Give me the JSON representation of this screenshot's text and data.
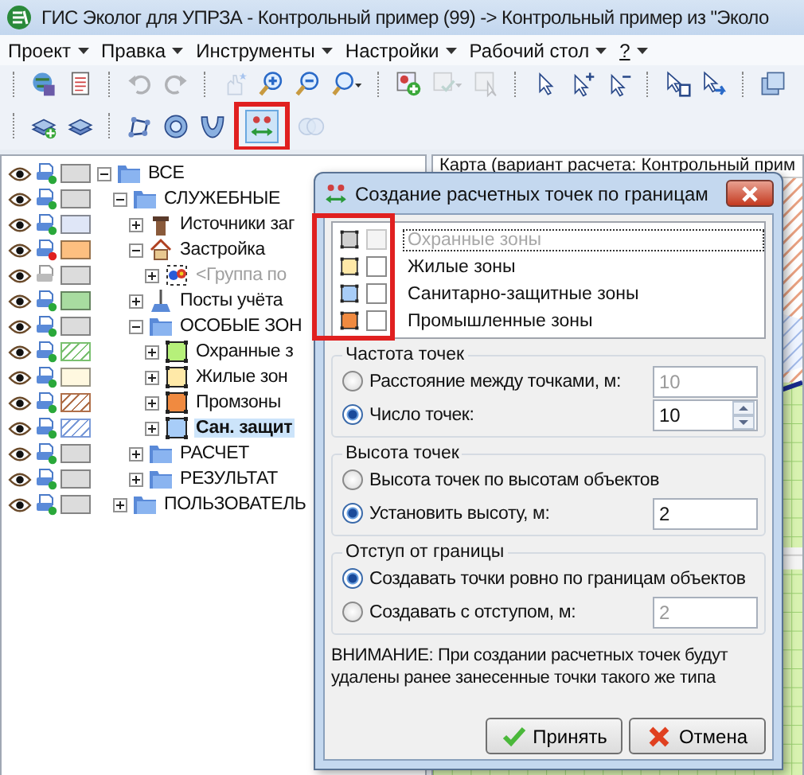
{
  "window": {
    "title": "ГИС Эколог для УПРЗА - Контрольный пример (99) -> Контрольный пример из \"Эколо"
  },
  "menu": [
    {
      "label": "Проект",
      "underline": false
    },
    {
      "label": "Правка",
      "underline": false
    },
    {
      "label": "Инструменты",
      "underline": false
    },
    {
      "label": "Настройки",
      "underline": false
    },
    {
      "label": "Рабочий стол",
      "underline": false
    },
    {
      "label": "?",
      "underline": true
    }
  ],
  "toolbars": [
    [
      {
        "kind": "separator"
      },
      {
        "kind": "globe-disk",
        "disabled": false,
        "selected": false,
        "annotated": false
      },
      {
        "kind": "document",
        "disabled": false,
        "selected": false,
        "annotated": false
      },
      {
        "kind": "separator"
      },
      {
        "kind": "undo",
        "disabled": true,
        "selected": false,
        "annotated": false
      },
      {
        "kind": "redo",
        "disabled": true,
        "selected": false,
        "annotated": false
      },
      {
        "kind": "separator"
      },
      {
        "kind": "hand",
        "disabled": true,
        "selected": false,
        "annotated": false
      },
      {
        "kind": "zoom-in",
        "disabled": false,
        "selected": false,
        "annotated": false
      },
      {
        "kind": "zoom-out",
        "disabled": false,
        "selected": false,
        "annotated": false
      },
      {
        "kind": "zoom-menu",
        "disabled": false,
        "selected": false,
        "annotated": false
      },
      {
        "kind": "separator"
      },
      {
        "kind": "add-object",
        "disabled": false,
        "selected": false,
        "annotated": false
      },
      {
        "kind": "edit-object",
        "disabled": true,
        "selected": false,
        "annotated": false
      },
      {
        "kind": "select-object",
        "disabled": true,
        "selected": false,
        "annotated": false
      },
      {
        "kind": "separator"
      },
      {
        "kind": "pointer",
        "disabled": false,
        "selected": false,
        "annotated": false
      },
      {
        "kind": "pointer-plus",
        "disabled": false,
        "selected": false,
        "annotated": false
      },
      {
        "kind": "pointer-minus",
        "disabled": false,
        "selected": false,
        "annotated": false
      },
      {
        "kind": "separator"
      },
      {
        "kind": "pointer-rect",
        "disabled": false,
        "selected": false,
        "annotated": false
      },
      {
        "kind": "pointer-move",
        "disabled": false,
        "selected": false,
        "annotated": false
      },
      {
        "kind": "separator"
      },
      {
        "kind": "squares",
        "disabled": false,
        "selected": false,
        "annotated": false
      }
    ],
    [
      {
        "kind": "separator"
      },
      {
        "kind": "layer-add",
        "disabled": false,
        "selected": false,
        "annotated": false
      },
      {
        "kind": "layer",
        "disabled": false,
        "selected": false,
        "annotated": false
      },
      {
        "kind": "separator"
      },
      {
        "kind": "polygon",
        "disabled": false,
        "selected": false,
        "annotated": false
      },
      {
        "kind": "ring",
        "disabled": false,
        "selected": false,
        "annotated": false
      },
      {
        "kind": "arc",
        "disabled": false,
        "selected": false,
        "annotated": false
      },
      {
        "kind": "boundary-points",
        "disabled": false,
        "selected": true,
        "annotated": true
      },
      {
        "kind": "circles",
        "disabled": true,
        "selected": false,
        "annotated": false
      }
    ]
  ],
  "tree": [
    {
      "label": "ВСЕ",
      "kind": "folder",
      "color": "#dcdcdc",
      "hatched": false,
      "alert": false,
      "expanded": true,
      "selected": false,
      "disabled": false,
      "children": [
        {
          "label": "СЛУЖЕБНЫЕ",
          "kind": "folder",
          "color": "#dcdcdc",
          "hatched": false,
          "alert": false,
          "expanded": true,
          "selected": false,
          "disabled": false,
          "children": [
            {
              "label": "Источники заг",
              "kind": "chimney",
              "color": "#dfe6f7",
              "hatched": false,
              "alert": false,
              "expanded": false,
              "selected": false,
              "disabled": false
            },
            {
              "label": "Застройка",
              "kind": "house",
              "color": "#fdbf80",
              "hatched": false,
              "alert": true,
              "expanded": true,
              "selected": false,
              "disabled": false,
              "children": [
                {
                  "label": "<Группа по",
                  "kind": "group",
                  "color": "#dcdcdc",
                  "hatched": false,
                  "alert": false,
                  "expanded": false,
                  "selected": false,
                  "disabled": true
                }
              ]
            },
            {
              "label": "Посты учёта",
              "kind": "post",
              "color": "#a8dca0",
              "hatched": false,
              "alert": false,
              "expanded": false,
              "selected": false,
              "disabled": false
            },
            {
              "label": "ОСОБЫЕ ЗОН",
              "kind": "folder",
              "color": "#dcdcdc",
              "hatched": false,
              "alert": false,
              "expanded": true,
              "selected": false,
              "disabled": false,
              "children": [
                {
                  "label": "Охранные з",
                  "kind": "zone",
                  "zone": {
                    "color": "#b6f07a"
                  },
                  "color": "#7ac070",
                  "hatched": true,
                  "alert": false,
                  "expanded": false,
                  "selected": false,
                  "disabled": false
                },
                {
                  "label": "Жилые зон",
                  "kind": "zone",
                  "zone": {
                    "color": "#ffe9a8"
                  },
                  "color": "#fff8e0",
                  "hatched": false,
                  "alert": false,
                  "expanded": false,
                  "selected": false,
                  "disabled": false
                },
                {
                  "label": "Промзоны",
                  "kind": "zone",
                  "zone": {
                    "color": "#f08a40"
                  },
                  "color": "#b0704a",
                  "hatched": true,
                  "alert": false,
                  "expanded": false,
                  "selected": false,
                  "disabled": false
                },
                {
                  "label": "Сан. защит",
                  "kind": "zone",
                  "zone": {
                    "color": "#a8cdf8"
                  },
                  "color": "#7a9ad8",
                  "hatched": true,
                  "alert": false,
                  "expanded": false,
                  "selected": true,
                  "disabled": false
                }
              ]
            },
            {
              "label": "РАСЧЕТ",
              "kind": "folder",
              "color": "#dcdcdc",
              "hatched": false,
              "alert": false,
              "expanded": false,
              "selected": false,
              "disabled": false
            },
            {
              "label": "РЕЗУЛЬТАТ",
              "kind": "folder",
              "color": "#dcdcdc",
              "hatched": false,
              "alert": false,
              "expanded": false,
              "selected": false,
              "disabled": false
            }
          ]
        },
        {
          "label": "ПОЛЬЗОВАТЕЛЬ",
          "kind": "folder",
          "color": "#dcdcdc",
          "hatched": false,
          "alert": false,
          "expanded": false,
          "selected": false,
          "disabled": false
        }
      ]
    }
  ],
  "map": {
    "header": "Карта (вариант расчета: Контрольный прим"
  },
  "dialog": {
    "title": "Создание расчетных точек по границам",
    "annotated": true,
    "zones": [
      {
        "label": "Охранные зоны",
        "color": "#d0d0d0",
        "checked": false,
        "disabled": true,
        "focused": true
      },
      {
        "label": "Жилые зоны",
        "color": "#ffe9a8",
        "checked": false,
        "disabled": false,
        "focused": false
      },
      {
        "label": "Санитарно-защитные зоны",
        "color": "#a8cdf8",
        "checked": false,
        "disabled": false,
        "focused": false
      },
      {
        "label": "Промышленные зоны",
        "color": "#f08a40",
        "checked": false,
        "disabled": false,
        "focused": false
      }
    ],
    "groups": [
      {
        "title": "Частота точек",
        "options": [
          {
            "label": "Расстояние между точками, м:",
            "selected": false,
            "field": {
              "value": "10",
              "disabled": true,
              "spinner": false
            }
          },
          {
            "label": "Число точек:",
            "selected": true,
            "field": {
              "value": "10",
              "disabled": false,
              "spinner": true
            }
          }
        ]
      },
      {
        "title": "Высота точек",
        "options": [
          {
            "label": "Высота точек по высотам объектов",
            "selected": false
          },
          {
            "label": "Установить высоту, м:",
            "selected": true,
            "field": {
              "value": "2",
              "disabled": false,
              "spinner": false
            }
          }
        ]
      },
      {
        "title": "Отступ от границы",
        "options": [
          {
            "label": "Создавать точки ровно по границам объектов",
            "selected": true
          },
          {
            "label": "Создавать с отступом, м:",
            "selected": false,
            "field": {
              "value": "2",
              "disabled": true,
              "spinner": false
            }
          }
        ]
      }
    ],
    "warning": "ВНИМАНИЕ: При создании расчетных точек будут удалены ранее занесенные точки такого же типа",
    "buttons": [
      {
        "label": "Принять",
        "kind": "accept"
      },
      {
        "label": "Отмена",
        "kind": "cancel"
      }
    ]
  }
}
